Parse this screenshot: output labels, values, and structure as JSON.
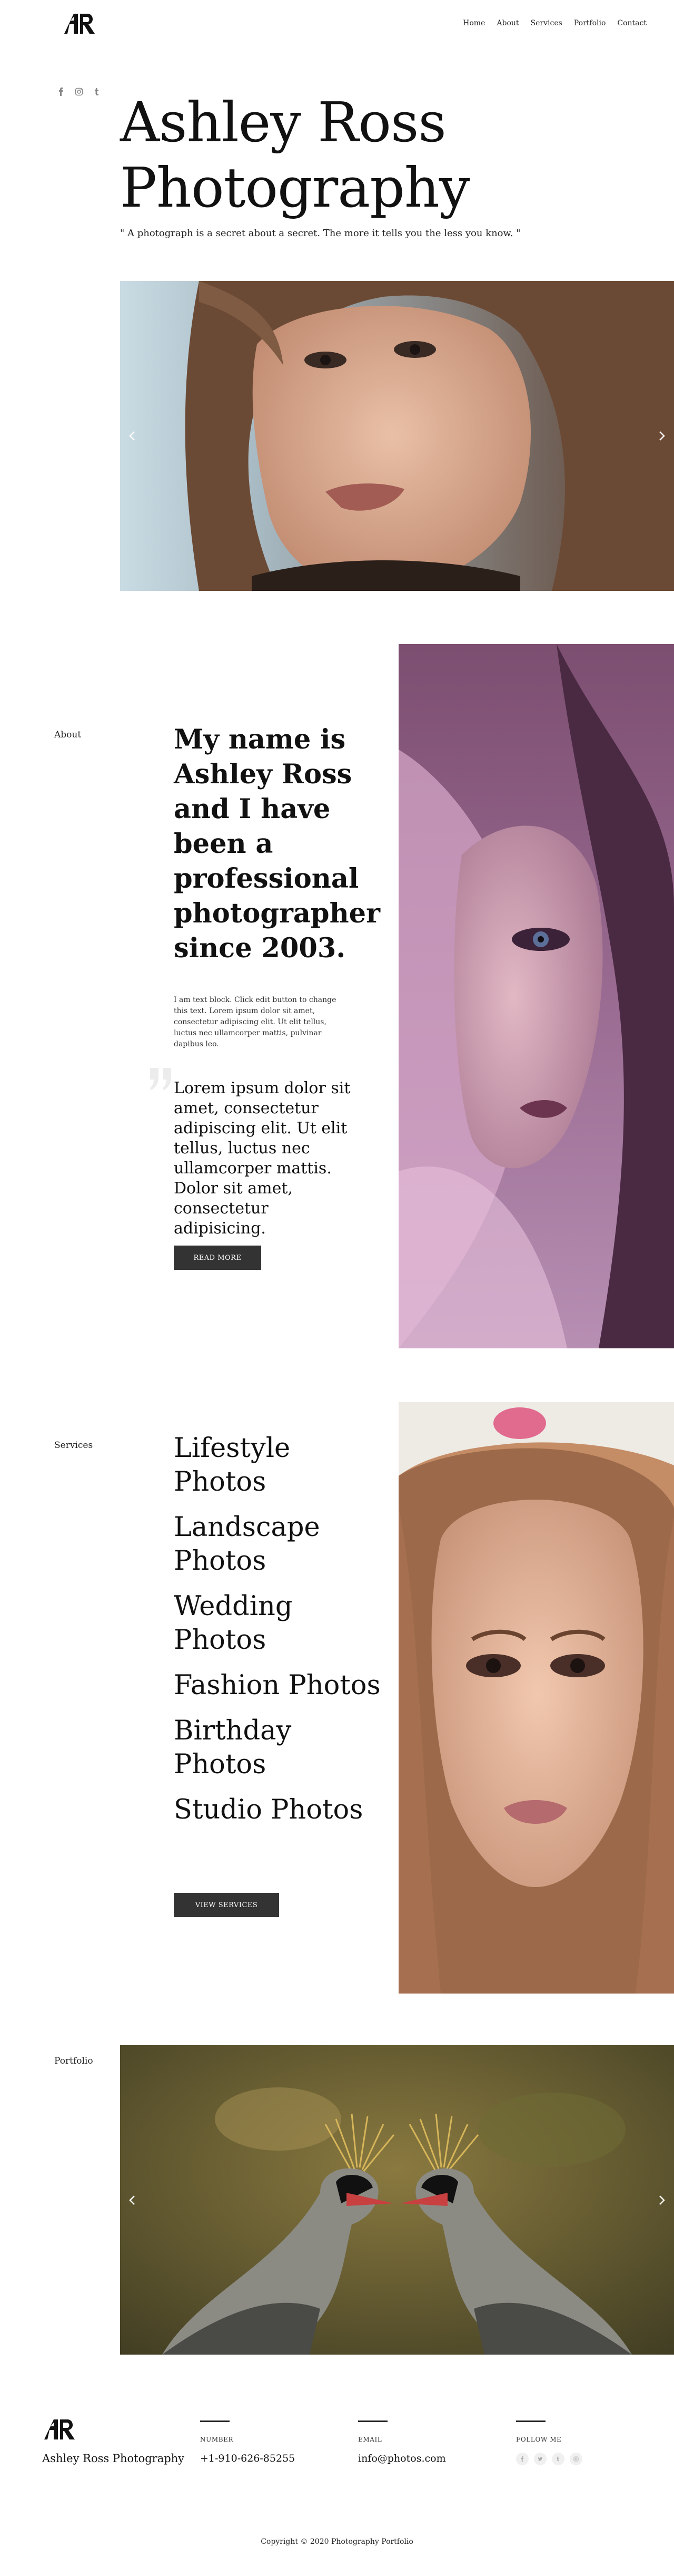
{
  "brand": {
    "logo_text": "AR"
  },
  "nav": {
    "items": [
      "Home",
      "About",
      "Services",
      "Portfolio",
      "Contact"
    ]
  },
  "hero": {
    "title_line1": "Ashley Ross",
    "title_line2": "Photography",
    "quote": "\" A photograph is a secret about a secret. The more it tells you the less you know. \"",
    "social_icons": [
      "facebook-icon",
      "instagram-icon",
      "tumblr-icon"
    ]
  },
  "about": {
    "label": "About",
    "heading": "My name is Ashley Ross and I have been a professional photographer since 2003.",
    "text": "I am text block. Click edit button to change this text. Lorem ipsum dolor sit amet, consectetur adipiscing elit. Ut elit tellus, luctus nec ullamcorper mattis, pulvinar dapibus leo.",
    "quote": "Lorem ipsum dolor sit amet, consectetur adipiscing elit. Ut elit tellus, luctus nec ullamcorper mattis. Dolor sit amet, consectetur adipisicing.",
    "button": "READ MORE"
  },
  "services": {
    "label": "Services",
    "items": [
      "Lifestyle Photos",
      "Landscape Photos",
      "Wedding Photos",
      "Fashion Photos",
      "Birthday Photos",
      "Studio Photos"
    ],
    "button": "VIEW SERVICES"
  },
  "portfolio": {
    "label": "Portfolio"
  },
  "footer": {
    "name": "Ashley Ross Photography",
    "number_label": "NUMBER",
    "number_value": "+1-910-626-85255",
    "email_label": "EMAIL",
    "email_value": "info@photos.com",
    "follow_label": "FOLLOW ME",
    "follow_icons": [
      "facebook-icon",
      "twitter-icon",
      "tumblr-icon",
      "instagram-icon"
    ],
    "copyright": "Copyright © 2020 Photography Portfolio"
  },
  "colors": {
    "button_bg": "#333333",
    "text": "#111111"
  }
}
